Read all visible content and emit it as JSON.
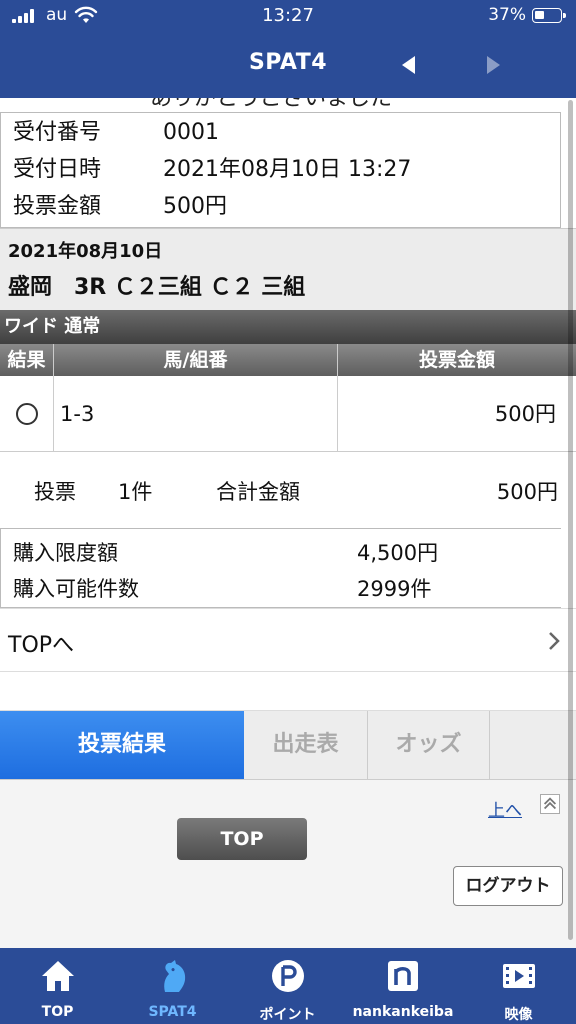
{
  "status_bar": {
    "carrier": "au",
    "time": "13:27",
    "battery": "37%"
  },
  "header": {
    "title": "SPAT4"
  },
  "partial_top_text": "ありがとうございました",
  "receipt": {
    "rows": [
      {
        "label": "受付番号",
        "value": "0001"
      },
      {
        "label": "受付日時",
        "value": "2021年08月10日 13:27"
      },
      {
        "label": "投票金額",
        "value": "500円"
      }
    ]
  },
  "race": {
    "date": "2021年08月10日",
    "name": "盛岡　3R Ｃ２三組 Ｃ２ 三組"
  },
  "bet_type": "ワイド 通常",
  "table": {
    "headers": [
      "結果",
      "馬/組番",
      "投票金額"
    ],
    "rows": [
      {
        "combo": "1-3",
        "amount": "500円"
      }
    ]
  },
  "summary": {
    "count_label": "投票",
    "count_value": "1件",
    "total_label": "合計金額",
    "total_value": "500円"
  },
  "limits": {
    "limit_label": "購入限度額",
    "limit_value": "4,500円",
    "count_label": "購入可能件数",
    "count_value": "2999件"
  },
  "top_link": "TOPへ",
  "tabs": [
    {
      "label": "投票結果",
      "active": true
    },
    {
      "label": "出走表",
      "active": false
    },
    {
      "label": "オッズ",
      "active": false
    }
  ],
  "footer": {
    "to_top": "上へ",
    "top_button": "TOP",
    "logout_button": "ログアウト"
  },
  "bottom_nav": [
    {
      "label": "TOP",
      "icon": "home-icon"
    },
    {
      "label": "SPAT4",
      "icon": "horse-icon",
      "active": true
    },
    {
      "label": "ポイント",
      "icon": "point-icon"
    },
    {
      "label": "nankankeiba",
      "icon": "n-logo-icon"
    },
    {
      "label": "映像",
      "icon": "video-icon"
    }
  ],
  "colors": {
    "header_bg": "#2b4c97",
    "active_tab": "#1e6ee0",
    "link": "#1f4fa8"
  }
}
